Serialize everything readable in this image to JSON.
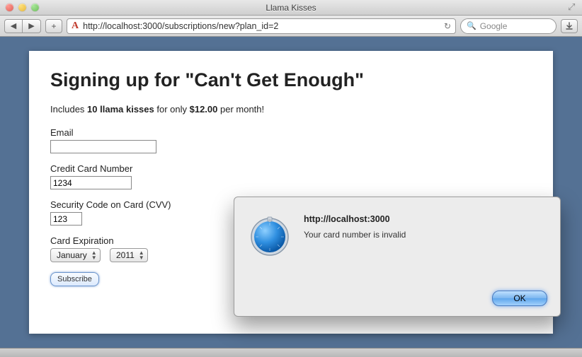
{
  "window": {
    "title": "Llama Kisses"
  },
  "toolbar": {
    "url": "http://localhost:3000/subscriptions/new?plan_id=2",
    "search_placeholder": "Google"
  },
  "page": {
    "heading": "Signing up for \"Can't Get Enough\"",
    "subline_prefix": "Includes ",
    "subline_bold1": "10 llama kisses",
    "subline_mid": " for only ",
    "subline_bold2": "$12.00",
    "subline_suffix": " per month!",
    "fields": {
      "email": {
        "label": "Email",
        "value": ""
      },
      "ccnum": {
        "label": "Credit Card Number",
        "value": "1234"
      },
      "cvv": {
        "label": "Security Code on Card (CVV)",
        "value": "123"
      },
      "expiration": {
        "label": "Card Expiration",
        "month": "January",
        "year": "2011"
      }
    },
    "subscribe_label": "Subscribe"
  },
  "alert": {
    "title": "http://localhost:3000",
    "message": "Your card number is invalid",
    "ok_label": "OK"
  }
}
